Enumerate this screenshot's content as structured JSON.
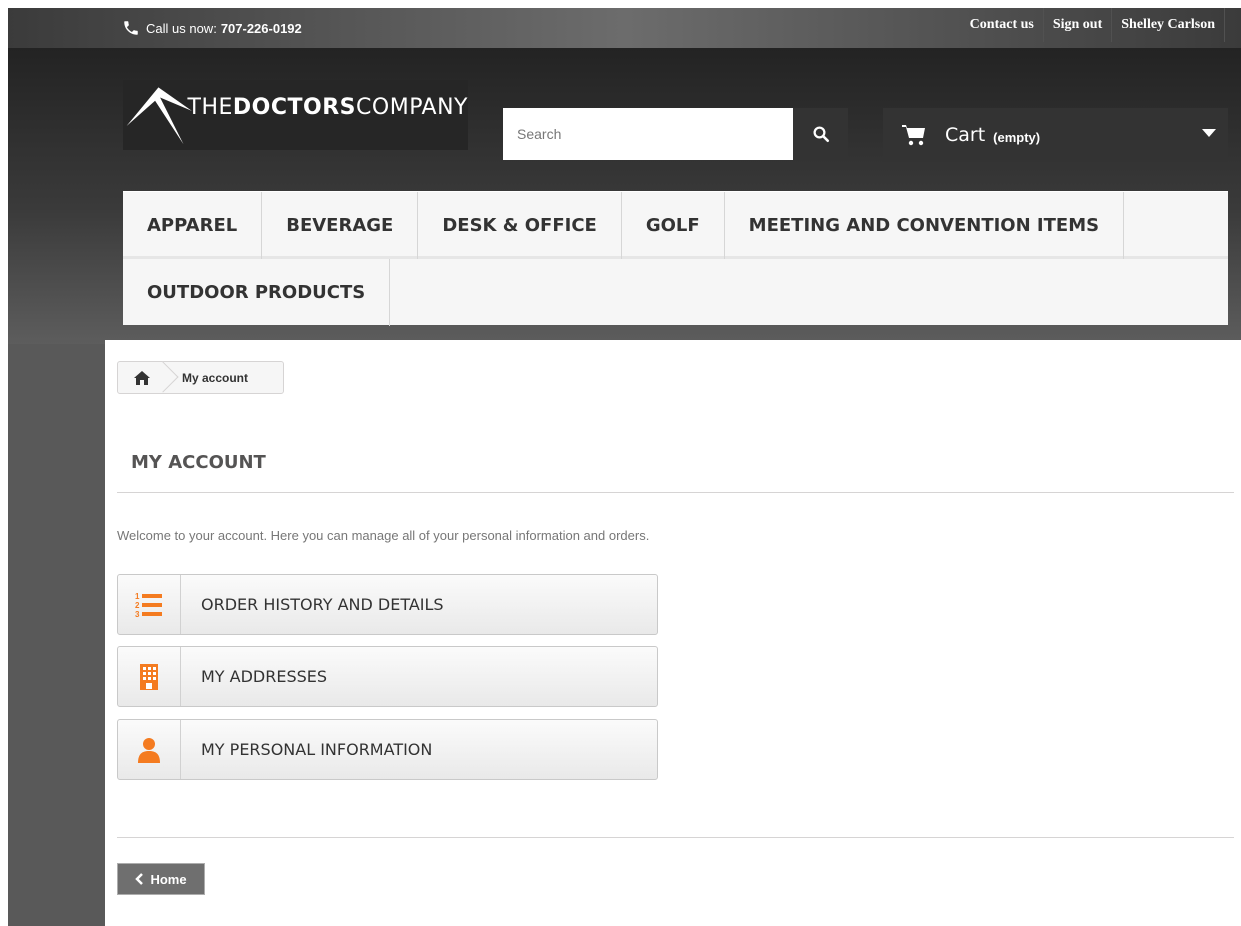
{
  "topbar": {
    "phone_label": "Call us now:",
    "phone_number": "707-226-0192",
    "links": [
      "Contact us",
      "Sign out",
      "Shelley Carlson"
    ]
  },
  "logo": {
    "brand_prefix": "THE",
    "brand_bold": "DOCTORS",
    "brand_suffix": "COMPANY"
  },
  "search": {
    "placeholder": "Search"
  },
  "cart": {
    "label": "Cart",
    "quantity": "(empty)"
  },
  "menu": {
    "row1": [
      "APPAREL",
      "BEVERAGE",
      "DESK & OFFICE",
      "GOLF",
      "MEETING AND CONVENTION ITEMS"
    ],
    "row2": [
      "OUTDOOR PRODUCTS"
    ]
  },
  "breadcrumb": {
    "current": "My account"
  },
  "page": {
    "title": "MY ACCOUNT",
    "intro": "Welcome to your account. Here you can manage all of your personal information and orders."
  },
  "account_links": [
    {
      "label": "ORDER HISTORY AND DETAILS",
      "icon": "list-ol-icon"
    },
    {
      "label": "MY ADDRESSES",
      "icon": "building-icon"
    },
    {
      "label": "MY PERSONAL INFORMATION",
      "icon": "user-icon"
    }
  ],
  "footer": {
    "home_label": "Home"
  },
  "colors": {
    "accent": "#f47b20",
    "dark": "#333333"
  }
}
